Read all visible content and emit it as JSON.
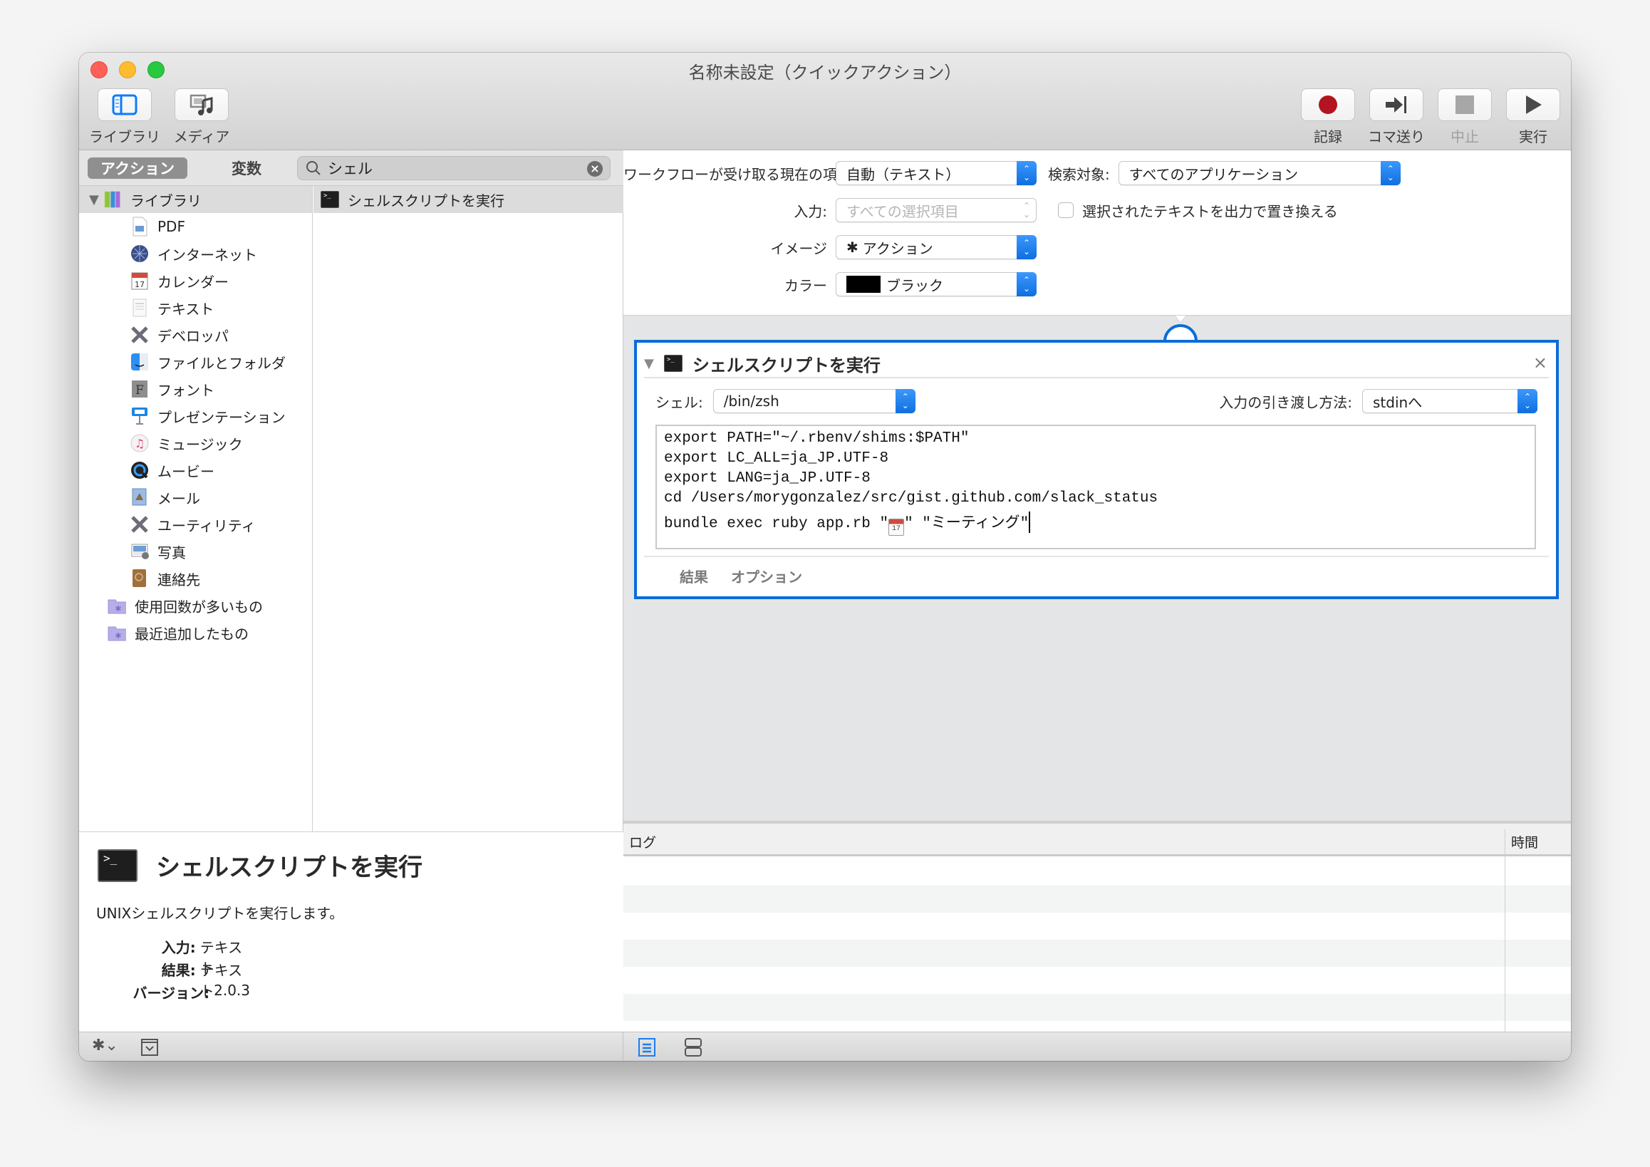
{
  "window": {
    "title": "名称未設定（クイックアクション）"
  },
  "toolbar": {
    "left": [
      {
        "label": "ライブラリ",
        "icon": "library-sidebar-icon"
      },
      {
        "label": "メディア",
        "icon": "media-icon"
      }
    ],
    "right": [
      {
        "label": "記録",
        "icon": "record-icon",
        "enabled": true
      },
      {
        "label": "コマ送り",
        "icon": "step-icon",
        "enabled": true
      },
      {
        "label": "中止",
        "icon": "stop-icon",
        "enabled": false
      },
      {
        "label": "実行",
        "icon": "run-icon",
        "enabled": true
      }
    ]
  },
  "library": {
    "segments": {
      "actions": "アクション",
      "variables": "変数",
      "selected": "アクション"
    },
    "search": {
      "value": "シェル",
      "placeholder": ""
    },
    "root": {
      "label": "ライブラリ",
      "expanded": true
    },
    "categories": [
      {
        "label": "PDF",
        "icon": "pdf-icon"
      },
      {
        "label": "インターネット",
        "icon": "globe-icon"
      },
      {
        "label": "カレンダー",
        "icon": "calendar-icon"
      },
      {
        "label": "テキスト",
        "icon": "text-icon"
      },
      {
        "label": "デベロッパ",
        "icon": "developer-icon"
      },
      {
        "label": "ファイルとフォルダ",
        "icon": "finder-icon"
      },
      {
        "label": "フォント",
        "icon": "font-icon"
      },
      {
        "label": "プレゼンテーション",
        "icon": "presentation-icon"
      },
      {
        "label": "ミュージック",
        "icon": "music-icon"
      },
      {
        "label": "ムービー",
        "icon": "quicktime-icon"
      },
      {
        "label": "メール",
        "icon": "mail-icon"
      },
      {
        "label": "ユーティリティ",
        "icon": "utility-icon"
      },
      {
        "label": "写真",
        "icon": "photos-icon"
      },
      {
        "label": "連絡先",
        "icon": "contacts-icon"
      }
    ],
    "smart_groups": [
      {
        "label": "使用回数が多いもの",
        "icon": "smart-folder-icon"
      },
      {
        "label": "最近追加したもの",
        "icon": "smart-folder-icon"
      }
    ],
    "results": [
      {
        "label": "シェルスクリプトを実行",
        "icon": "terminal-icon",
        "selected": true
      }
    ]
  },
  "description": {
    "title": "シェルスクリプトを実行",
    "text": "UNIXシェルスクリプトを実行します。",
    "fields": [
      {
        "key": "入力:",
        "value": "テキスト"
      },
      {
        "key": "結果:",
        "value": "テキスト"
      },
      {
        "key": "バージョン:",
        "value": "2.0.3"
      }
    ]
  },
  "settings": {
    "receives_label": "ワークフローが受け取る現在の項目:",
    "receives_value": "自動（テキスト）",
    "search_target_label": "検索対象:",
    "search_target_value": "すべてのアプリケーション",
    "input_label": "入力:",
    "input_value": "すべての選択項目",
    "replace_label": "選択されたテキストを出力で置き換える",
    "replace_checked": false,
    "image_label": "イメージ",
    "image_value": "アクション",
    "color_label": "カラー",
    "color_value": "ブラック",
    "color_swatch": "#000000"
  },
  "action_card": {
    "title": "シェルスクリプトを実行",
    "shell_label": "シェル:",
    "shell_value": "/bin/zsh",
    "pass_label": "入力の引き渡し方法:",
    "pass_value": "stdinへ",
    "code_lines": [
      "export PATH=\"~/.rbenv/shims:$PATH\"",
      "export LC_ALL=ja_JP.UTF-8",
      "export LANG=ja_JP.UTF-8",
      "cd /Users/morygonzalez/src/gist.github.com/slack_status"
    ],
    "code_last_prefix": "bundle exec ruby app.rb \"",
    "code_last_emoji": "📆",
    "code_last_suffix": "\" \"ミーティング\"",
    "tabs": [
      "結果",
      "オプション"
    ],
    "accent": "#0a6cd9"
  },
  "log": {
    "columns": [
      "ログ",
      "時間"
    ],
    "rows": []
  }
}
